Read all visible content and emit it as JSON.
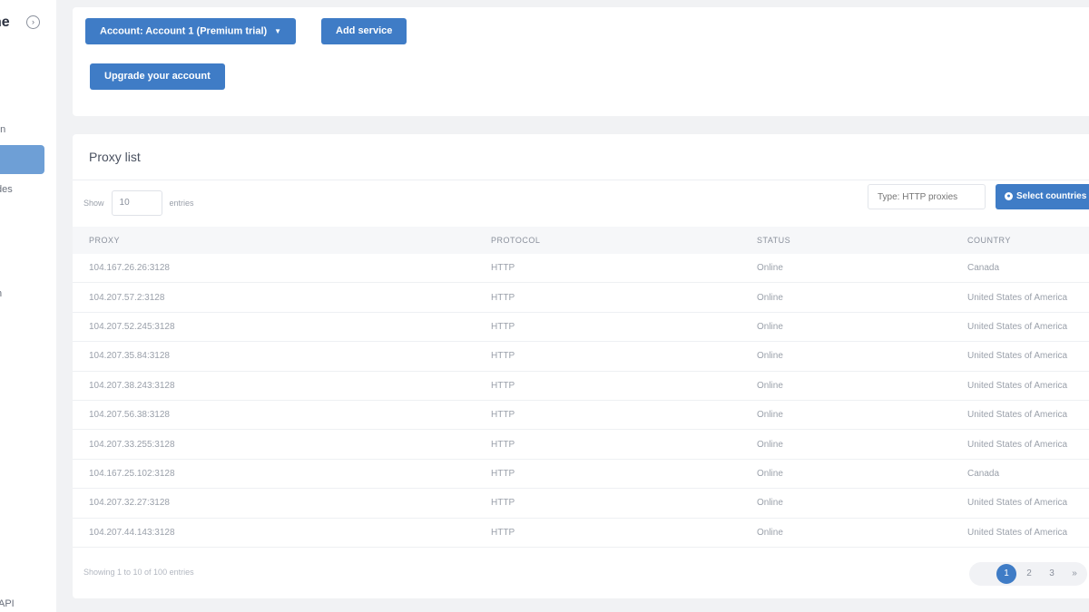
{
  "sidebar": {
    "brand_fragment": "ne",
    "toggle_icon": "chevron-right-icon",
    "items": [
      {
        "label": "on"
      },
      {
        "label": ""
      },
      {
        "label": "des"
      },
      {
        "label": "n"
      },
      {
        "label": "API"
      }
    ]
  },
  "toolbar": {
    "account_label": "Account: Account 1 (Premium trial)",
    "add_service_label": "Add service",
    "upgrade_label": "Upgrade your account"
  },
  "proxy_list": {
    "title": "Proxy list",
    "show_label": "Show",
    "show_value": "10",
    "entries_label": "entries",
    "search_placeholder": "Type: HTTP proxies",
    "select_countries_label": "Select countries",
    "columns": [
      "PROXY",
      "PROTOCOL",
      "STATUS",
      "COUNTRY"
    ],
    "rows": [
      {
        "proxy": "104.167.26.26:3128",
        "protocol": "HTTP",
        "status": "Online",
        "country": "Canada"
      },
      {
        "proxy": "104.207.57.2:3128",
        "protocol": "HTTP",
        "status": "Online",
        "country": "United States of America"
      },
      {
        "proxy": "104.207.52.245:3128",
        "protocol": "HTTP",
        "status": "Online",
        "country": "United States of America"
      },
      {
        "proxy": "104.207.35.84:3128",
        "protocol": "HTTP",
        "status": "Online",
        "country": "United States of America"
      },
      {
        "proxy": "104.207.38.243:3128",
        "protocol": "HTTP",
        "status": "Online",
        "country": "United States of America"
      },
      {
        "proxy": "104.207.56.38:3128",
        "protocol": "HTTP",
        "status": "Online",
        "country": "United States of America"
      },
      {
        "proxy": "104.207.33.255:3128",
        "protocol": "HTTP",
        "status": "Online",
        "country": "United States of America"
      },
      {
        "proxy": "104.167.25.102:3128",
        "protocol": "HTTP",
        "status": "Online",
        "country": "Canada"
      },
      {
        "proxy": "104.207.32.27:3128",
        "protocol": "HTTP",
        "status": "Online",
        "country": "United States of America"
      },
      {
        "proxy": "104.207.44.143:3128",
        "protocol": "HTTP",
        "status": "Online",
        "country": "United States of America"
      }
    ],
    "footer_info": "Showing 1 to 10 of 100 entries",
    "pages": [
      "1",
      "2",
      "3",
      "»"
    ],
    "current_page": "1"
  },
  "colors": {
    "accent": "#3f7cc6",
    "sidebar_active": "#6e9fd6",
    "background": "#f1f2f4"
  }
}
